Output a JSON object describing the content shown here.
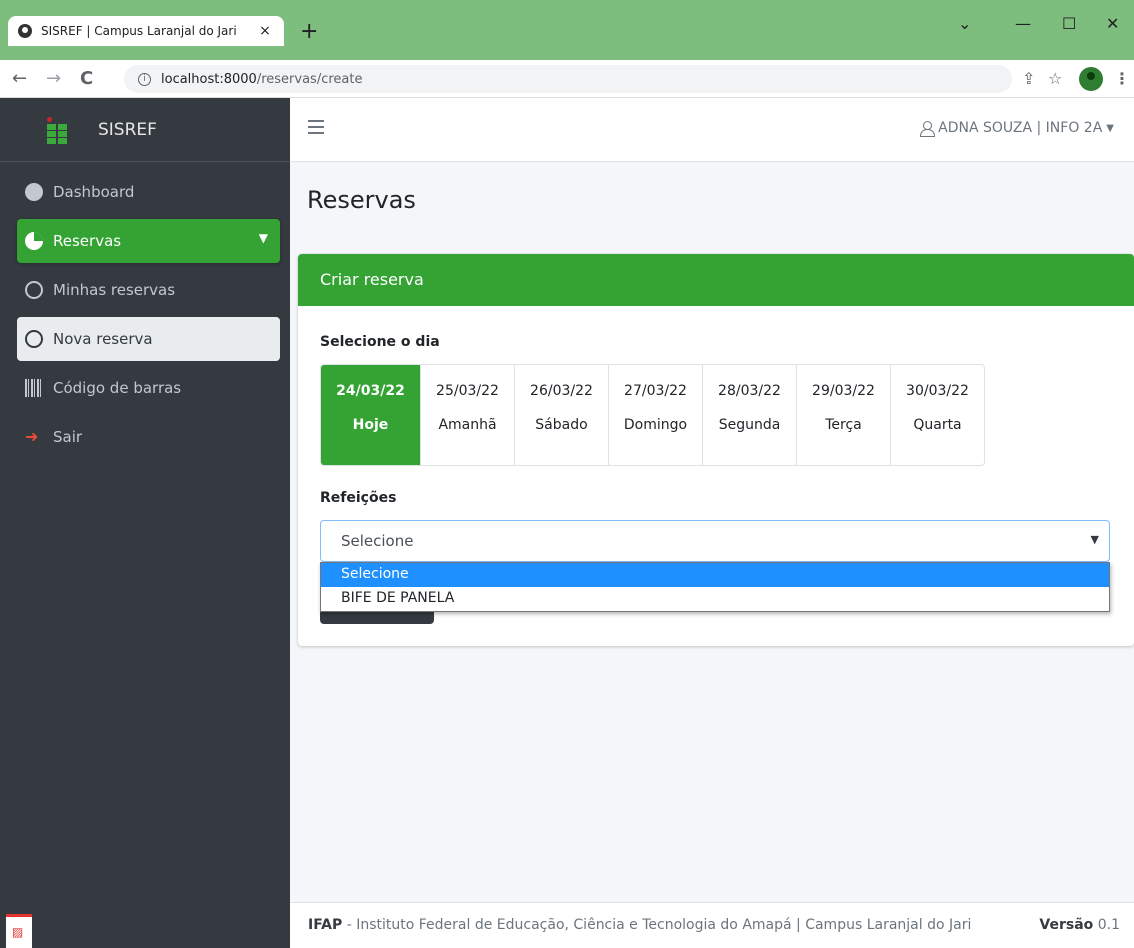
{
  "browser": {
    "tab_title": "SISREF | Campus Laranjal do Jari",
    "tab_close": "×",
    "new_tab": "+",
    "url_host": "localhost:8000",
    "url_path": "/reservas/create"
  },
  "sidebar": {
    "brand": "SISREF",
    "items": [
      {
        "label": "Dashboard"
      },
      {
        "label": "Reservas"
      },
      {
        "label": "Minhas reservas"
      },
      {
        "label": "Nova reserva"
      },
      {
        "label": "Código de barras"
      },
      {
        "label": "Sair"
      }
    ],
    "active_color": "#34a334"
  },
  "header": {
    "user": "ADNA SOUZA | INFO 2A"
  },
  "page": {
    "title": "Reservas",
    "card_title": "Criar reserva",
    "day_label": "Selecione o dia",
    "meal_label": "Refeições",
    "days": [
      {
        "date": "24/03/22",
        "name": "Hoje"
      },
      {
        "date": "25/03/22",
        "name": "Amanhã"
      },
      {
        "date": "26/03/22",
        "name": "Sábado"
      },
      {
        "date": "27/03/22",
        "name": "Domingo"
      },
      {
        "date": "28/03/22",
        "name": "Segunda"
      },
      {
        "date": "29/03/22",
        "name": "Terça"
      },
      {
        "date": "30/03/22",
        "name": "Quarta"
      }
    ],
    "select_value": "Selecione",
    "options": [
      "Selecione",
      "BIFE DE PANELA"
    ]
  },
  "footer": {
    "org": "IFAP",
    "text": " - Instituto Federal de Educação, Ciência e Tecnologia do Amapá | Campus Laranjal do Jari",
    "version_label": "Versão",
    "version": "0.1"
  }
}
